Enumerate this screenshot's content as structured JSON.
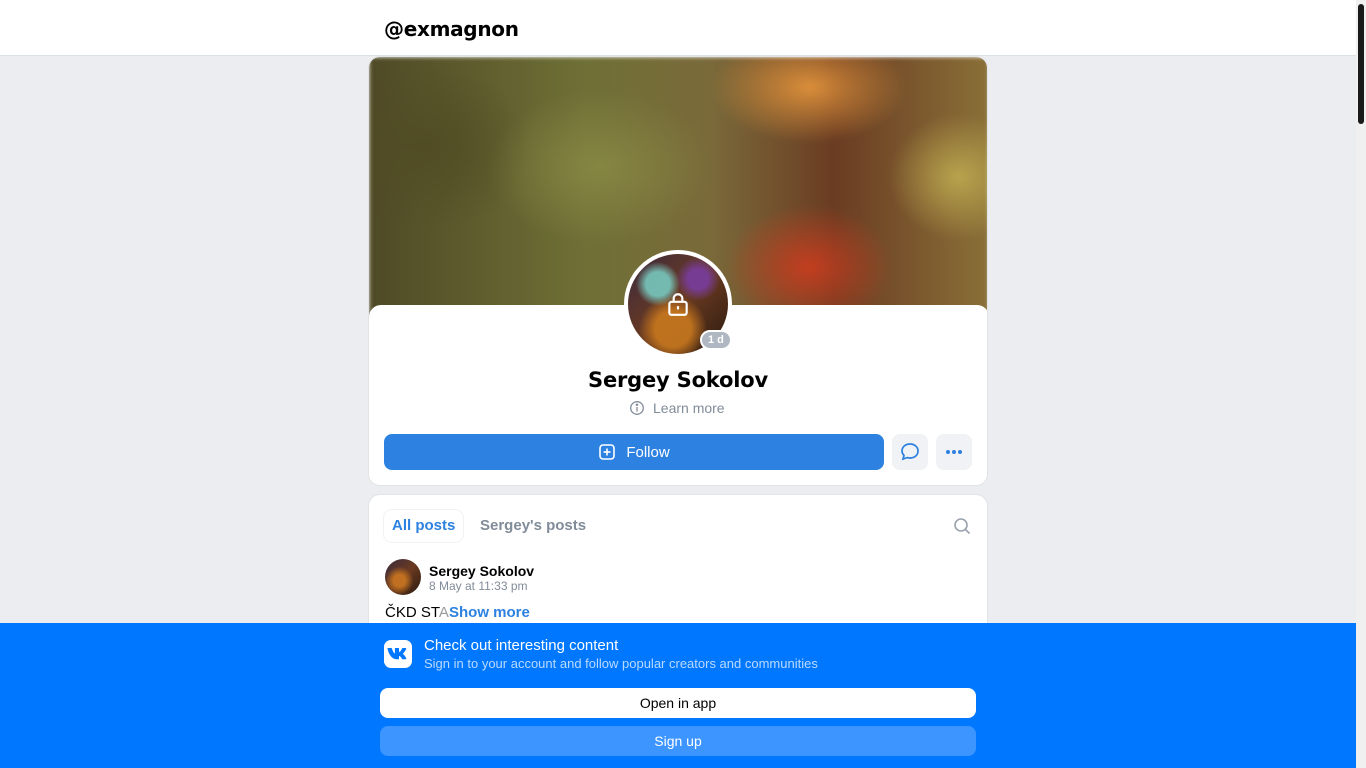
{
  "header": {
    "handle": "@exmagnon"
  },
  "profile": {
    "name": "Sergey Sokolov",
    "last_seen_badge": "1 d",
    "learn_more": "Learn more",
    "follow_label": "Follow"
  },
  "tabs": [
    {
      "label": "All posts",
      "active": true
    },
    {
      "label": "Sergey's posts",
      "active": false
    }
  ],
  "post": {
    "author": "Sergey Sokolov",
    "date": "8 May at 11:33 pm",
    "text_start": "ČKD ST",
    "text_faded": "A",
    "show_more": "Show more"
  },
  "banner": {
    "title": "Check out interesting content",
    "subtitle": "Sign in to your account and follow popular creators and communities",
    "open_app": "Open in app",
    "sign_up": "Sign up"
  },
  "colors": {
    "accent": "#2d81e0",
    "banner_bg": "#0077ff",
    "page_bg": "#ebedf0"
  }
}
